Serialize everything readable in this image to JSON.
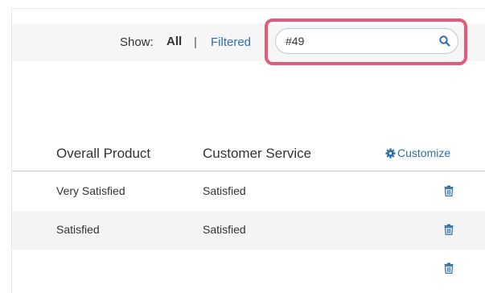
{
  "filter": {
    "show_label": "Show:",
    "all_label": "All",
    "separator": "|",
    "filtered_label": "Filtered"
  },
  "search": {
    "value": "#49",
    "icon": "search-icon"
  },
  "table": {
    "columns": [
      "Overall Product",
      "Customer Service"
    ],
    "customize_label": "Customize",
    "rows": [
      {
        "overall_product": "Very Satisfied",
        "customer_service": "Satisfied"
      },
      {
        "overall_product": "Satisfied",
        "customer_service": "Satisfied"
      },
      {
        "overall_product": "",
        "customer_service": ""
      }
    ]
  },
  "colors": {
    "highlight": "#e45a7e",
    "link": "#2f6fad",
    "search_border": "#b9c9e6"
  }
}
